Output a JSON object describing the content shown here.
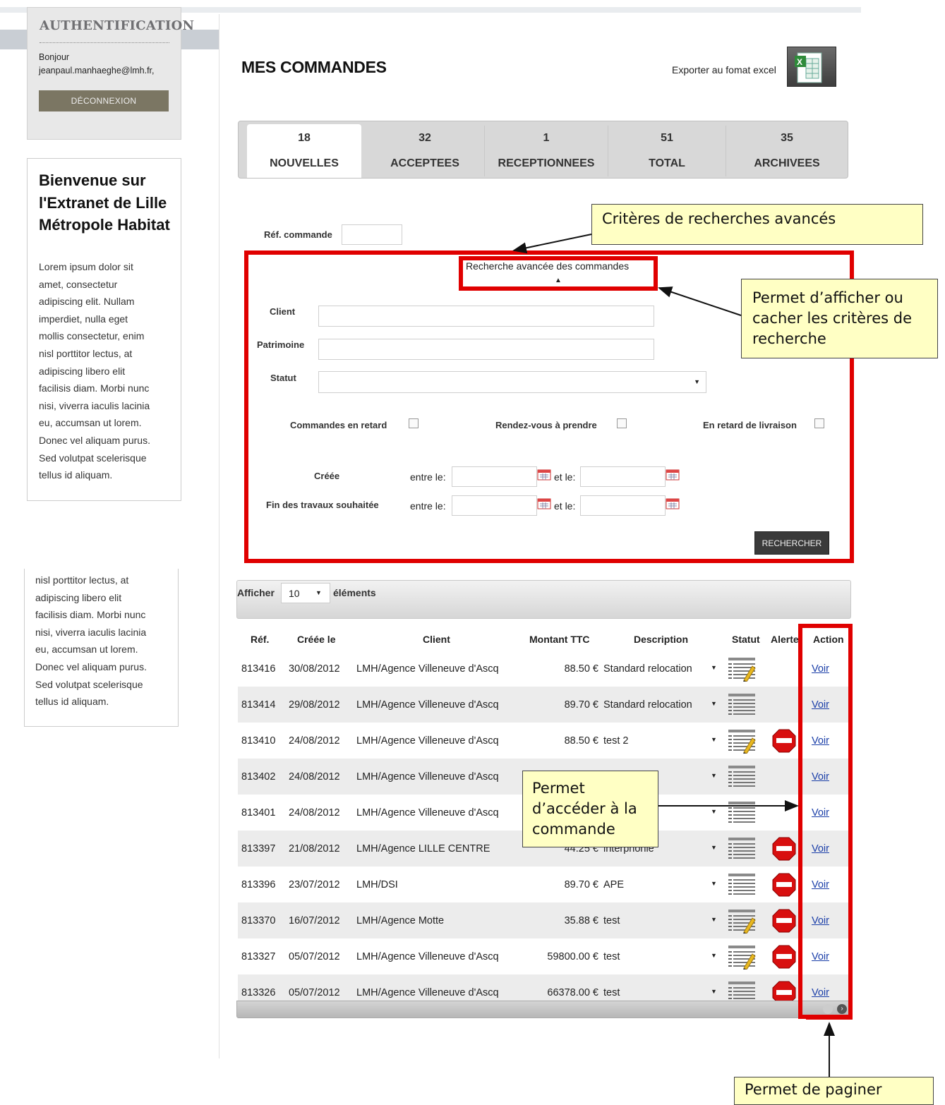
{
  "sidebar": {
    "auth_title": "AUTHENTIFICATION",
    "greeting": "Bonjour",
    "user_email": "jeanpaul.manhaeghe@lmh.fr,",
    "logout_label": "DÉCONNEXION",
    "welcome_title": "Bienvenue sur l'Extranet de Lille Métropole Habitat",
    "welcome_lines": [
      "Lorem ipsum dolor sit",
      "amet, consectetur",
      "adipiscing elit. Nullam",
      "imperdiet, nulla eget",
      "mollis consectetur, enim",
      "nisl porttitor lectus, at",
      "adipiscing libero elit",
      "facilisis diam. Morbi nunc",
      "nisi, viverra iaculis lacinia",
      "eu, accumsan ut lorem.",
      "Donec vel aliquam purus.",
      "Sed volutpat scelerisque",
      "tellus id aliquam."
    ],
    "welcome_lines_2": [
      "nisl porttitor lectus, at",
      "adipiscing libero elit",
      "facilisis diam. Morbi nunc",
      "nisi, viverra iaculis lacinia",
      "eu, accumsan ut lorem.",
      "Donec vel aliquam purus.",
      "Sed volutpat scelerisque",
      "tellus id aliquam."
    ]
  },
  "header": {
    "title": "MES COMMANDES",
    "export_label": "Exporter au fomat excel"
  },
  "tabs": [
    {
      "count": "18",
      "label": "NOUVELLES"
    },
    {
      "count": "32",
      "label": "ACCEPTEES"
    },
    {
      "count": "1",
      "label": "RECEPTIONNEES"
    },
    {
      "count": "51",
      "label": "TOTAL"
    },
    {
      "count": "35",
      "label": "ARCHIVEES"
    }
  ],
  "search": {
    "ref_label": "Réf. commande",
    "advanced_toggle": "Recherche avancée des commandes",
    "client_label": "Client",
    "patrimoine_label": "Patrimoine",
    "statut_label": "Statut",
    "late_orders_label": "Commandes en retard",
    "appointment_label": "Rendez-vous à prendre",
    "late_delivery_label": "En retard de livraison",
    "created_label": "Créée",
    "end_works_label": "Fin des travaux souhaitée",
    "between_label": "entre le:",
    "and_label": "et le:",
    "search_button": "RECHERCHER"
  },
  "table": {
    "show_label": "Afficher",
    "page_size": "10",
    "elements_label": "éléments",
    "columns": [
      "Réf.",
      "Créée le",
      "Client",
      "Montant TTC",
      "Description",
      "Statut",
      "Alerte",
      "Action"
    ],
    "rows": [
      {
        "ref": "813416",
        "date": "30/08/2012",
        "client": "LMH/Agence Villeneuve d'Ascq",
        "amount": "88.50 €",
        "desc": "Standard relocation",
        "status_icon": "pencil-list-icon",
        "alert": false,
        "action": "Voir"
      },
      {
        "ref": "813414",
        "date": "29/08/2012",
        "client": "LMH/Agence Villeneuve d'Ascq",
        "amount": "89.70 €",
        "desc": "Standard relocation",
        "status_icon": "list-icon",
        "alert": false,
        "action": "Voir"
      },
      {
        "ref": "813410",
        "date": "24/08/2012",
        "client": "LMH/Agence Villeneuve d'Ascq",
        "amount": "88.50 €",
        "desc": "test 2",
        "status_icon": "pencil-list-icon",
        "alert": true,
        "action": "Voir"
      },
      {
        "ref": "813402",
        "date": "24/08/2012",
        "client": "LMH/Agence Villeneuve d'Ascq",
        "amount": "",
        "desc": "",
        "status_icon": "list-icon",
        "alert": false,
        "action": "Voir"
      },
      {
        "ref": "813401",
        "date": "24/08/2012",
        "client": "LMH/Agence Villeneuve d'Ascq",
        "amount": "",
        "desc": "",
        "status_icon": "list-icon",
        "alert": false,
        "action": "Voir"
      },
      {
        "ref": "813397",
        "date": "21/08/2012",
        "client": "LMH/Agence LILLE CENTRE",
        "amount": "44.25 €",
        "desc": "interphonie",
        "status_icon": "list-icon",
        "alert": true,
        "action": "Voir"
      },
      {
        "ref": "813396",
        "date": "23/07/2012",
        "client": "LMH/DSI",
        "amount": "89.70 €",
        "desc": "APE",
        "status_icon": "list-icon",
        "alert": true,
        "action": "Voir"
      },
      {
        "ref": "813370",
        "date": "16/07/2012",
        "client": "LMH/Agence Motte",
        "amount": "35.88 €",
        "desc": "test",
        "status_icon": "pencil-list-icon",
        "alert": true,
        "action": "Voir"
      },
      {
        "ref": "813327",
        "date": "05/07/2012",
        "client": "LMH/Agence Villeneuve d'Ascq",
        "amount": "59800.00 €",
        "desc": "test",
        "status_icon": "pencil-list-icon",
        "alert": true,
        "action": "Voir"
      },
      {
        "ref": "813326",
        "date": "05/07/2012",
        "client": "LMH/Agence Villeneuve d'Ascq",
        "amount": "66378.00 €",
        "desc": "test",
        "status_icon": "list-icon",
        "alert": true,
        "action": "Voir"
      }
    ]
  },
  "annotations": {
    "advanced_criteria": "Critères de recherches avancés",
    "toggle_criteria": "Permet d’afficher ou cacher les critères de recherche",
    "access_order": "Permet d’accéder à la commande",
    "pagination": "Permet de paginer",
    "colors": {
      "highlight": "#e00000",
      "note_bg": "#ffffc4"
    }
  }
}
